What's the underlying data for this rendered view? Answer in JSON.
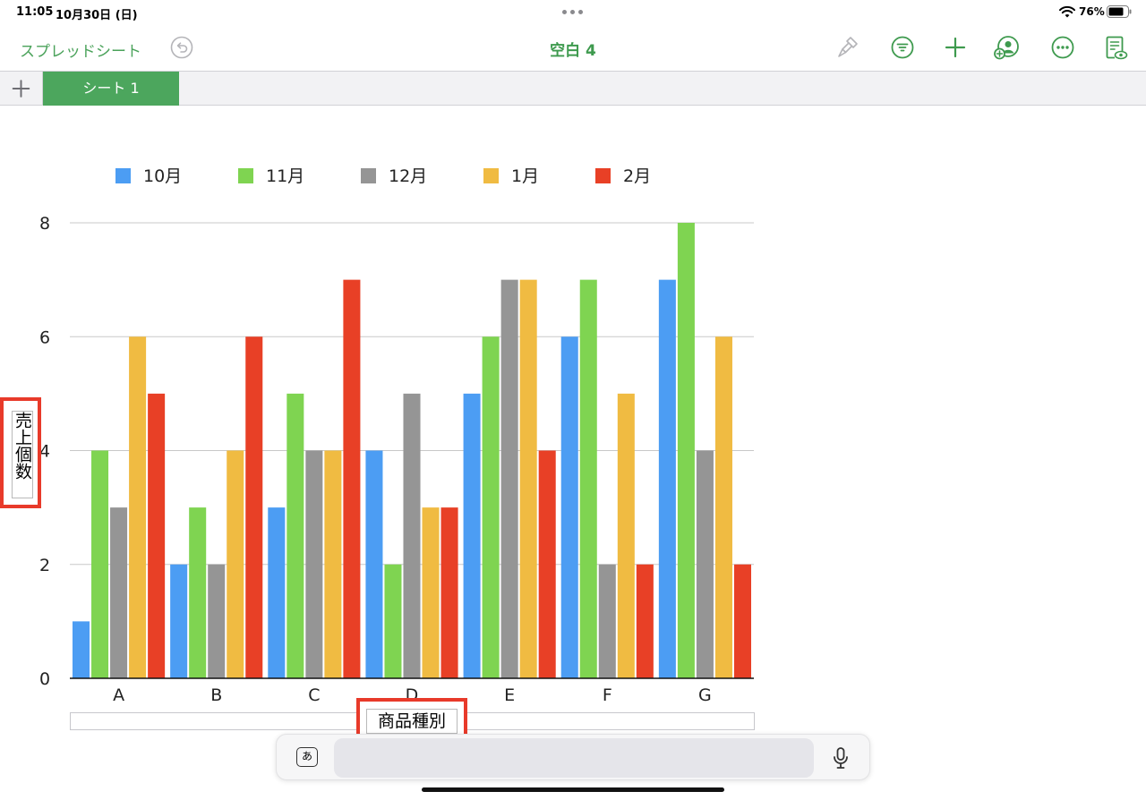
{
  "status_bar": {
    "time": "11:05",
    "date": "10月30日 (日)",
    "battery": "76%"
  },
  "toolbar": {
    "back_label": "スプレッドシート",
    "title": "空白 4",
    "accent_color": "#4aa25a",
    "icons": [
      "undo-icon",
      "paintbrush-icon",
      "filter-icon",
      "plus-icon",
      "collaborate-icon",
      "more-icon",
      "document-view-icon"
    ]
  },
  "sheets": {
    "add_icon": "plus-icon",
    "tabs": [
      {
        "label": "シート 1",
        "active": true
      }
    ]
  },
  "chart_data": {
    "type": "bar",
    "categories": [
      "A",
      "B",
      "C",
      "D",
      "E",
      "F",
      "G"
    ],
    "series": [
      {
        "name": "10月",
        "color": "#4c9df3",
        "values": [
          1,
          2,
          3,
          4,
          5,
          6,
          7
        ]
      },
      {
        "name": "11月",
        "color": "#7fd451",
        "values": [
          4,
          3,
          5,
          2,
          6,
          7,
          8
        ]
      },
      {
        "name": "12月",
        "color": "#959595",
        "values": [
          3,
          2,
          4,
          5,
          7,
          2,
          4
        ]
      },
      {
        "name": "1月",
        "color": "#f0bb42",
        "values": [
          6,
          4,
          4,
          3,
          7,
          5,
          6
        ]
      },
      {
        "name": "2月",
        "color": "#e84026",
        "values": [
          5,
          6,
          7,
          3,
          4,
          2,
          2
        ]
      }
    ],
    "ylim": [
      0,
      8
    ],
    "yticks": [
      0,
      2,
      4,
      6,
      8
    ],
    "xlabel": "商品種別",
    "ylabel": "売上個数",
    "legend": "top",
    "grid": true
  },
  "annotations": {
    "highlight_color": "#e83a2a"
  },
  "keyboard_bar": {
    "kana_key": "あ",
    "mic_icon": "microphone-icon",
    "input_value": ""
  }
}
